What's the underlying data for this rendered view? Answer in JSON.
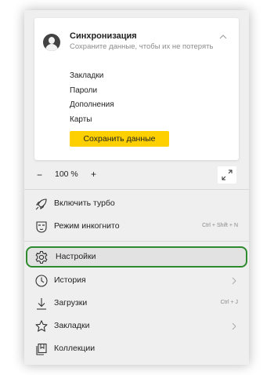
{
  "sync": {
    "title": "Синхронизация",
    "subtitle": "Сохраните данные, чтобы их не потерять",
    "items": [
      "Закладки",
      "Пароли",
      "Дополнения",
      "Карты"
    ],
    "save_label": "Сохранить данные"
  },
  "zoom": {
    "minus": "−",
    "value": "100 %",
    "plus": "+"
  },
  "menu": {
    "turbo": {
      "label": "Включить турбо",
      "icon": "rocket-icon"
    },
    "incognito": {
      "label": "Режим инкогнито",
      "shortcut": "Ctrl + Shift + N",
      "icon": "incognito-mask-icon"
    },
    "settings": {
      "label": "Настройки",
      "icon": "gear-icon"
    },
    "history": {
      "label": "История",
      "icon": "clock-icon"
    },
    "downloads": {
      "label": "Загрузки",
      "shortcut": "Ctrl + J",
      "icon": "download-icon"
    },
    "bookmarks": {
      "label": "Закладки",
      "icon": "star-icon"
    },
    "collections": {
      "label": "Коллекции",
      "icon": "collections-icon"
    }
  },
  "colors": {
    "accent_button": "#ffd000",
    "highlight_border": "#2d8b2d",
    "menu_bg": "#efefef"
  }
}
